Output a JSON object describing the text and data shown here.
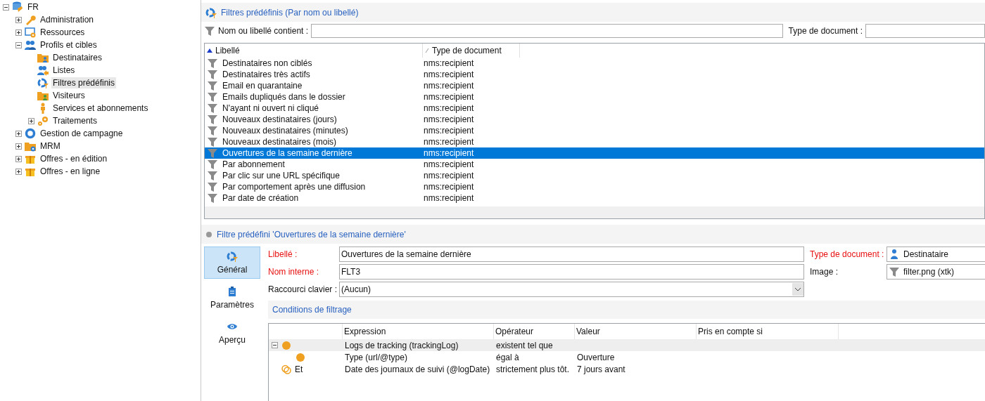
{
  "tree": [
    {
      "label": "FR",
      "kind": "database",
      "expanded": true,
      "selected": false,
      "children": [
        {
          "label": "Administration",
          "kind": "wrench",
          "expanded": false,
          "selected": false
        },
        {
          "label": "Ressources",
          "kind": "window-gear",
          "expanded": false,
          "selected": false
        },
        {
          "label": "Profils et cibles",
          "kind": "people",
          "expanded": true,
          "selected": false,
          "children": [
            {
              "label": "Destinataires",
              "kind": "folder-person",
              "selected": false
            },
            {
              "label": "Listes",
              "kind": "people-arrow",
              "selected": false
            },
            {
              "label": "Filtres prédéfinis",
              "kind": "ring-filter",
              "selected": true
            },
            {
              "label": "Visiteurs",
              "kind": "folder-visitor",
              "selected": false
            },
            {
              "label": "Services et abonnements",
              "kind": "person",
              "selected": false
            },
            {
              "label": "Traitements",
              "kind": "gears",
              "expanded": false,
              "selected": false
            }
          ]
        },
        {
          "label": "Gestion de campagne",
          "kind": "ring",
          "expanded": false,
          "selected": false
        },
        {
          "label": "MRM",
          "kind": "folder-gear",
          "expanded": false,
          "selected": false
        },
        {
          "label": "Offres - en édition",
          "kind": "gift",
          "expanded": false,
          "selected": false
        },
        {
          "label": "Offres - en ligne",
          "kind": "gift",
          "expanded": false,
          "selected": false
        }
      ]
    }
  ],
  "list_panel": {
    "title": "Filtres prédéfinis (Par nom ou libellé)",
    "filter_label": "Nom ou libellé contient :",
    "doctype_label": "Type de document :",
    "columns": [
      {
        "label": "Libellé",
        "kind": "sorted"
      },
      {
        "label": "Type de document",
        "kind": "plain"
      }
    ],
    "rows": [
      {
        "label": "Destinataires non ciblés",
        "type": "nms:recipient",
        "selected": false
      },
      {
        "label": "Destinataires très actifs",
        "type": "nms:recipient",
        "selected": false
      },
      {
        "label": "Email en quarantaine",
        "type": "nms:recipient",
        "selected": false
      },
      {
        "label": "Emails dupliqués dans le dossier",
        "type": "nms:recipient",
        "selected": false
      },
      {
        "label": "N'ayant ni ouvert ni cliqué",
        "type": "nms:recipient",
        "selected": false
      },
      {
        "label": "Nouveaux destinataires (jours)",
        "type": "nms:recipient",
        "selected": false
      },
      {
        "label": "Nouveaux destinataires (minutes)",
        "type": "nms:recipient",
        "selected": false
      },
      {
        "label": "Nouveaux destinataires (mois)",
        "type": "nms:recipient",
        "selected": false
      },
      {
        "label": "Ouvertures de la semaine dernière",
        "type": "nms:recipient",
        "selected": true
      },
      {
        "label": "Par abonnement",
        "type": "nms:recipient",
        "selected": false
      },
      {
        "label": "Par clic sur une URL spécifique",
        "type": "nms:recipient",
        "selected": false
      },
      {
        "label": "Par comportement après une diffusion",
        "type": "nms:recipient",
        "selected": false
      },
      {
        "label": "Par date de création",
        "type": "nms:recipient",
        "selected": false
      }
    ]
  },
  "detail": {
    "title": "Filtre prédéfini 'Ouvertures de la semaine dernière'",
    "tabs": [
      {
        "label": "Général",
        "kind": "ring-filter",
        "selected": true
      },
      {
        "label": "Paramètres",
        "kind": "clipboard",
        "selected": false
      },
      {
        "label": "Aperçu",
        "kind": "eye",
        "selected": false
      }
    ],
    "fields": [
      {
        "label": "Libellé :",
        "value": "Ouvertures de la semaine dernière",
        "required": true,
        "kind": "text"
      },
      {
        "label": "Nom interne :",
        "value": "FLT3",
        "required": true,
        "kind": "text"
      },
      {
        "label": "Raccourci clavier :",
        "value": "(Aucun)",
        "required": false,
        "kind": "select"
      }
    ],
    "side_fields": [
      {
        "label": "Type de document :",
        "value": "Destinataire",
        "required": true,
        "kind": "person-blue"
      },
      {
        "label": "Image :",
        "value": "filter.png (xtk)",
        "required": false,
        "kind": "funnel"
      }
    ],
    "conditions": {
      "title": "Conditions de filtrage",
      "columns": [
        "Expression",
        "Opérateur",
        "Valeur",
        "Pris en compte si"
      ],
      "rows": [
        {
          "kind": "filled",
          "expression": "Logs de tracking (trackingLog)",
          "operator": "existent tel que",
          "selected": true,
          "expanded": true,
          "children": [
            {
              "kind": "filled",
              "expression": "Type (url/@type)",
              "operator": "égal à",
              "value": "Ouverture",
              "selected": false
            }
          ]
        },
        {
          "kind": "rings",
          "prefix": "Et",
          "expression": "Date des journaux de suivi (@logDate)",
          "operator": "strictement plus tôt.",
          "value": "7 jours avant",
          "selected": false
        }
      ]
    }
  }
}
